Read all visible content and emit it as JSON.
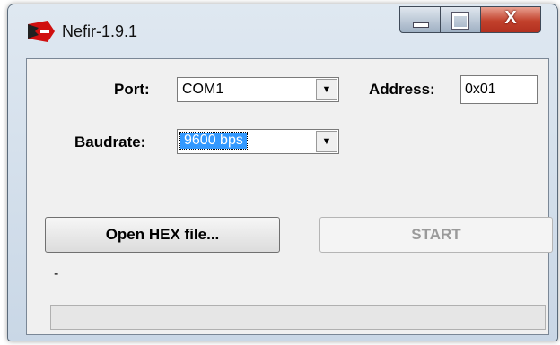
{
  "window": {
    "title": "Nefir-1.9.1",
    "close_glyph": "X"
  },
  "form": {
    "port_label": "Port:",
    "port_value": "COM1",
    "address_label": "Address:",
    "address_value": "0x01",
    "baudrate_label": "Baudrate:",
    "baudrate_value": "9600 bps"
  },
  "buttons": {
    "open_hex": "Open HEX file...",
    "start": "START"
  },
  "status": {
    "text": "-",
    "progress": 0
  },
  "icons": {
    "app": "nefir-app-icon",
    "dropdown": "chevron-down-icon"
  }
}
